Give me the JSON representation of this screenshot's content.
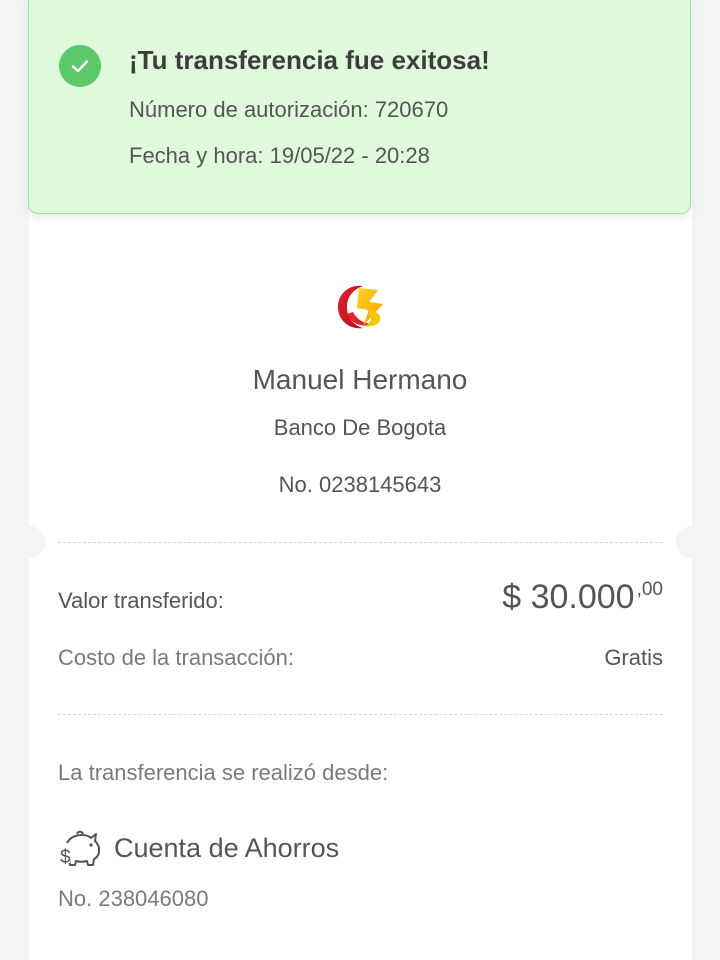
{
  "banner": {
    "title": "¡Tu transferencia fue exitosa!",
    "authorization": "Número de autorización: 720670",
    "datetime": "Fecha y hora: 19/05/22 - 20:28",
    "icon": "check-icon",
    "background_color": "#dffbdb",
    "check_color": "#5cc96a"
  },
  "recipient": {
    "bank_logo": "banco-de-bogota-logo",
    "name": "Manuel Hermano",
    "bank": "Banco De Bogota",
    "account_number": "No. 0238145643"
  },
  "transfer": {
    "amount_label": "Valor transferido:",
    "amount_main": "$ 30.000",
    "amount_cents": ",00",
    "cost_label": "Costo de la transacción:",
    "cost_value": "Gratis"
  },
  "origin": {
    "label": "La transferencia se realizó desde:",
    "icon": "piggy-bank-icon",
    "account_type": "Cuenta de Ahorros",
    "account_number": "No. 238046080"
  }
}
